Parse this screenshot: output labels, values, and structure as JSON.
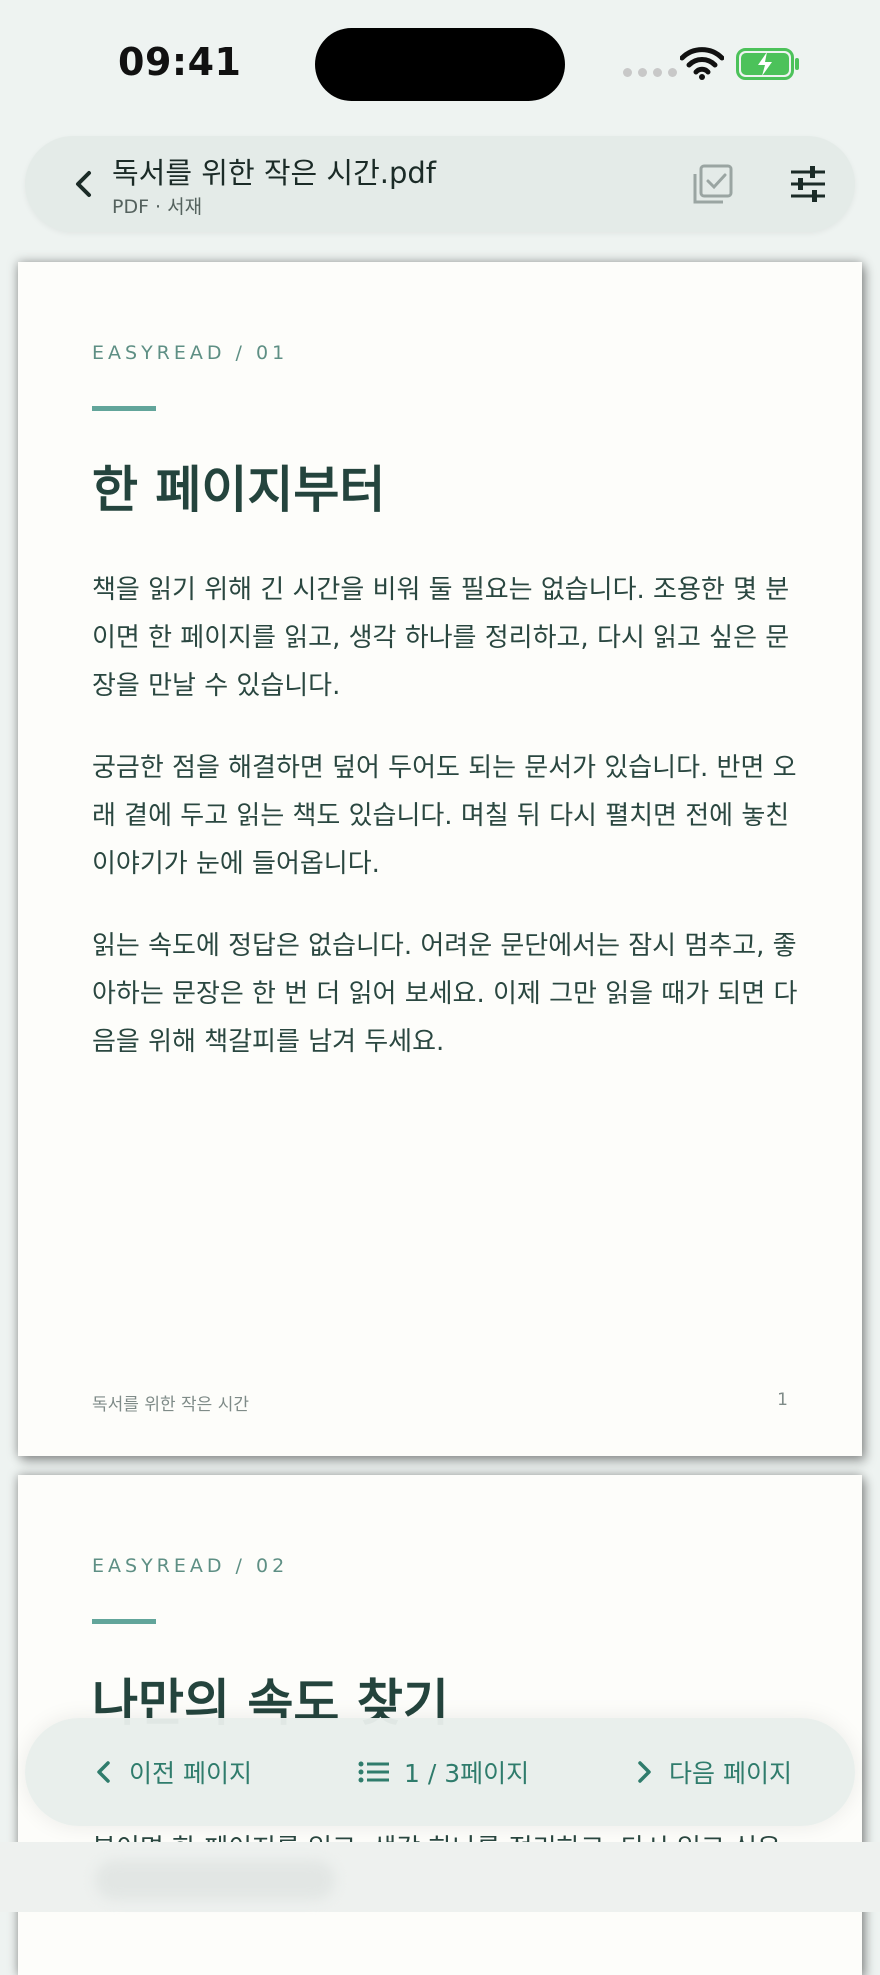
{
  "status_bar": {
    "time": "09:41"
  },
  "toolbar": {
    "title": "독서를 위한 작은 시간.pdf",
    "subtitle": "PDF · 서재"
  },
  "pages": [
    {
      "eyebrow": "EASYREAD / 01",
      "heading": "한 페이지부터",
      "paragraphs": [
        "책을 읽기 위해 긴 시간을 비워 둘 필요는 없습니다. 조용한 몇 분이면 한 페이지를 읽고, 생각 하나를 정리하고, 다시 읽고 싶은 문장을 만날 수 있습니다.",
        "궁금한 점을 해결하면 덮어 두어도 되는 문서가 있습니다. 반면 오래 곁에 두고 읽는 책도 있습니다. 며칠 뒤 다시 펼치면 전에 놓친 이야기가 눈에 들어옵니다.",
        "읽는 속도에 정답은 없습니다. 어려운 문단에서는 잠시 멈추고, 좋아하는 문장은 한 번 더 읽어 보세요. 이제 그만 읽을 때가 되면 다음을 위해 책갈피를 남겨 두세요."
      ],
      "footer_title": "독서를 위한 작은 시간",
      "footer_page": "1"
    },
    {
      "eyebrow": "EASYREAD / 02",
      "heading": "나만의 속도 찾기",
      "paragraphs": [
        "분이면 한 페이지를 읽고, 생각 하나를 정리하고, 다시 읽고 싶은"
      ]
    }
  ],
  "bottom_nav": {
    "prev_label": "이전 페이지",
    "page_indicator": "1 / 3페이지",
    "next_label": "다음 페이지"
  },
  "colors": {
    "accent": "#2f7c6c",
    "heading": "#24443d",
    "rule": "#62a59a",
    "battery": "#4cc25a"
  }
}
